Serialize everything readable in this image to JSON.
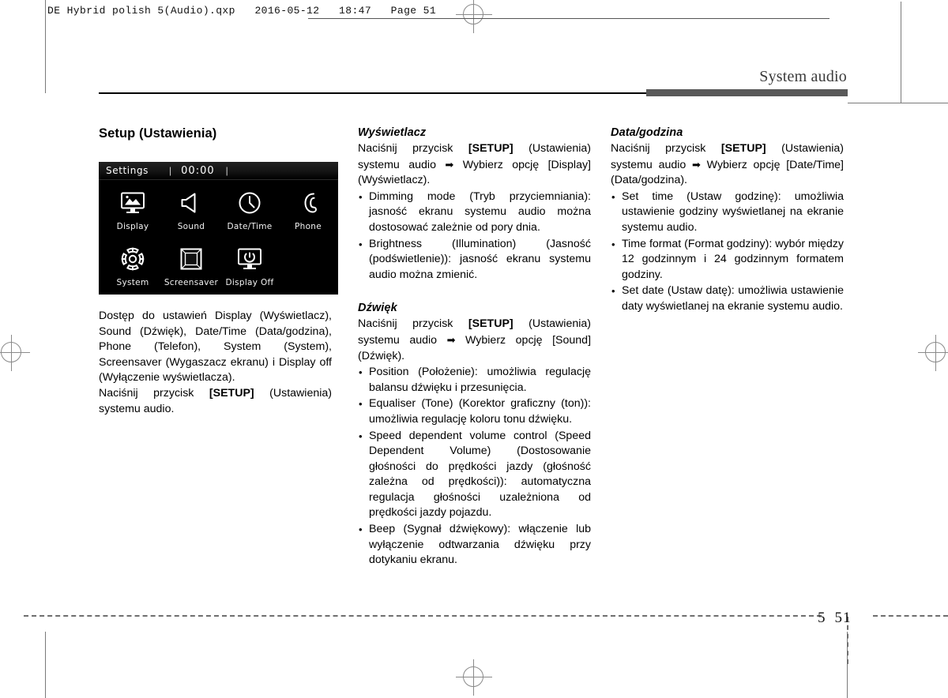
{
  "slug": {
    "text": "DE Hybrid polish 5(Audio).qxp   2016-05-12   18:47   Page 51"
  },
  "header": {
    "title": "System audio"
  },
  "footer": {
    "chapter": "5",
    "page": "51"
  },
  "columns": {
    "left": {
      "section_title": "Setup (Ustawienia)",
      "screen": {
        "title": "Settings",
        "separator": "|",
        "clock": "00:00",
        "separator2": "|",
        "tiles": [
          {
            "label": "Display",
            "icon": "monitor-image-icon"
          },
          {
            "label": "Sound",
            "icon": "speaker-icon"
          },
          {
            "label": "Date/Time",
            "icon": "clock-icon"
          },
          {
            "label": "Phone",
            "icon": "phone-handset-icon"
          },
          {
            "label": "System",
            "icon": "gear-icon"
          },
          {
            "label": "Screensaver",
            "icon": "beveled-square-icon"
          },
          {
            "label": "Display Off",
            "icon": "monitor-power-icon"
          }
        ]
      },
      "paragraph_1": "Dostęp do ustawień Display (Wyświetlacz), Sound (Dźwięk), Date/Time (Data/godzina), Phone (Telefon), System (System), Screensaver (Wygaszacz ekranu) i Display off (Wyłączenie wyświetlacza).",
      "paragraph_2_pre": "Naciśnij przycisk ",
      "paragraph_2_bold": "[SETUP]",
      "paragraph_2_post": " (Ustawienia) systemu audio."
    },
    "middle": {
      "section_a": {
        "title": "Wyświetlacz",
        "intro_pre": "Naciśnij przycisk ",
        "intro_bold": "[SETUP]",
        "intro_mid": " (Ustawienia) systemu audio ",
        "intro_arrow": "➡",
        "intro_post": " Wybierz opcję [Display] (Wyświetlacz).",
        "bullets": [
          "Dimming mode (Tryb przyciemniania): jasność ekranu systemu audio można dostosować zależnie od pory dnia.",
          "Brightness (Illumination) (Jasność (podświetlenie)): jasność ekranu systemu audio można zmienić."
        ]
      },
      "section_b": {
        "title": "Dźwięk",
        "intro_pre": "Naciśnij przycisk ",
        "intro_bold": "[SETUP]",
        "intro_mid": " (Ustawienia) systemu audio ",
        "intro_arrow": "➡",
        "intro_post": " Wybierz opcję [Sound] (Dźwięk).",
        "bullets": [
          "Position (Położenie): umożliwia regulację balansu dźwięku i przesunięcia.",
          "Equaliser (Tone) (Korektor graficzny (ton)): umożliwia regulację koloru tonu dźwięku.",
          "Speed dependent volume control (Speed Dependent Volume) (Dostosowanie głośności do prędkości jazdy (głośność zależna od prędkości)): automatyczna regulacja głośności uzależniona od prędkości jazdy pojazdu.",
          "Beep (Sygnał dźwiękowy): włączenie lub wyłączenie odtwarzania dźwięku przy dotykaniu ekranu."
        ]
      }
    },
    "right": {
      "section": {
        "title": "Data/godzina",
        "intro_pre": "Naciśnij przycisk ",
        "intro_bold": "[SETUP]",
        "intro_mid": " (Ustawienia) systemu audio ",
        "intro_arrow": "➡",
        "intro_post": " Wybierz opcję [Date/Time] (Data/godzina).",
        "bullets": [
          "Set time (Ustaw godzinę): umożliwia ustawienie godziny wyświetlanej na ekranie systemu audio.",
          "Time format (Format godziny): wybór między 12 godzinnym i 24 godzinnym formatem godziny.",
          "Set date (Ustaw datę): umożliwia ustawienie daty wyświetlanej na ekranie systemu audio."
        ]
      }
    }
  }
}
